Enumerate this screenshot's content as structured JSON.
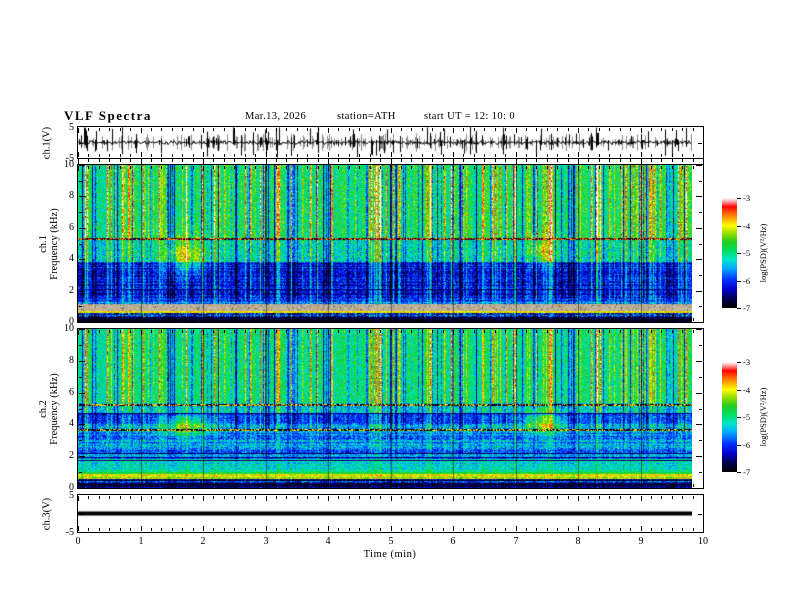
{
  "header": {
    "title": "VLF Spectra",
    "date": "Mar.13, 2026",
    "station": "station=ATH",
    "start_ut": "start UT =  12: 10: 0"
  },
  "time_axis": {
    "label": "Time  (min)",
    "min": 0,
    "max": 10,
    "tick_labels": [
      "0",
      "1",
      "2",
      "3",
      "4",
      "5",
      "6",
      "7",
      "8",
      "9",
      "10"
    ],
    "minor_ticks_per_interval": 5
  },
  "colorbar": {
    "label": "log(PSD)(V²/Hz)",
    "vmin": -7,
    "vmax": -3,
    "tick_labels": [
      "-3",
      "-4",
      "-5",
      "-6",
      "-7"
    ],
    "tick_values": [
      -3,
      -4,
      -5,
      -6,
      -7
    ],
    "stops": [
      [
        0.0,
        "#000000"
      ],
      [
        0.09,
        "#000055"
      ],
      [
        0.17,
        "#0000cc"
      ],
      [
        0.26,
        "#0033ff"
      ],
      [
        0.36,
        "#00aaff"
      ],
      [
        0.44,
        "#00e6cc"
      ],
      [
        0.52,
        "#00e060"
      ],
      [
        0.6,
        "#22cc22"
      ],
      [
        0.68,
        "#99dd00"
      ],
      [
        0.75,
        "#ffff00"
      ],
      [
        0.81,
        "#ffaa00"
      ],
      [
        0.87,
        "#ff5500"
      ],
      [
        0.92,
        "#ff0000"
      ],
      [
        0.965,
        "#ff9999"
      ],
      [
        1.0,
        "#ffffff"
      ]
    ]
  },
  "colors": {
    "trace": "#000000",
    "trace_shadow": "#8a8a8a",
    "frame": "#000000",
    "background": "#ffffff"
  },
  "sferics": {
    "seed": 20260313,
    "p_strong": 0.17,
    "strong_min": 0.55,
    "strong_max": 1.9,
    "p_quiet": 0.15,
    "quiet_min": 0.5,
    "quiet_max": 1.6,
    "jitter": 0.55,
    "smooth": 0.28
  },
  "chart_data": [
    {
      "id": "wave1",
      "type": "line",
      "title": "ch.1 time series",
      "ylabel": "ch.1(V)",
      "ylim": [
        -5,
        5
      ],
      "ytick_labels": [
        "5",
        "-5"
      ],
      "ytick_values": [
        5,
        -5
      ],
      "xlim_min": [
        0,
        10
      ],
      "data_end_min": 9.82,
      "description": "broadband VLF noise around 0 V with dense impulsive sferic spikes reaching ±5 V",
      "seed": 11,
      "center_jitter_v": 0.8,
      "gray_p": 0.34,
      "gray_vmax": 3.0,
      "spike_p": 0.17,
      "spike_vmax": 5
    },
    {
      "id": "spec1",
      "type": "heatmap",
      "title": "ch.1 spectrogram",
      "ylabel_lines": [
        "ch.1",
        "Frequency  (kHz)"
      ],
      "ylim": [
        0,
        10
      ],
      "ytick_values": [
        0,
        2,
        4,
        6,
        8,
        10
      ],
      "xlim_min": [
        0,
        10
      ],
      "data_end_min": 9.82,
      "value_label": "log(PSD)(V²/Hz)",
      "vlim": [
        -7,
        -3
      ],
      "seed": 42,
      "zones": [
        {
          "f0": 5.35,
          "f1": 10.01,
          "base": -4.85,
          "noise": 0.5,
          "gain": 1.5,
          "rowband": 0.0
        },
        {
          "f0": 3.85,
          "f1": 5.35,
          "base": -5.2,
          "noise": 0.55,
          "gain": 1.05,
          "rowband": 0.2
        },
        {
          "f0": 1.5,
          "f1": 3.85,
          "base": -6.15,
          "noise": 0.45,
          "gain": 0.8,
          "rowband": 0.6
        },
        {
          "f0": 1.15,
          "f1": 1.5,
          "base": -5.8,
          "noise": 0.5,
          "gain": 0.5,
          "rowband": 0.7
        },
        {
          "f0": 0.65,
          "f1": 1.15,
          "type": "gray"
        },
        {
          "f0": 0.3,
          "f1": 0.65,
          "base": -6.2,
          "noise": 0.85,
          "gain": 0.55,
          "rowband": 1.0
        },
        {
          "f0": 0.0,
          "f1": 0.3,
          "base": -6.8,
          "noise": 0.35,
          "gain": 0.3,
          "rowband": 1.0
        }
      ],
      "lines": [
        {
          "f": 5.3,
          "hw": 0.08,
          "v": -3.6,
          "dark": true
        },
        {
          "f": 0.63,
          "hw": 0.05,
          "v": -4.0
        },
        {
          "f": 2.08,
          "hw": 0.045,
          "v": -6.55
        },
        {
          "f": 0.13,
          "hw": 0.05,
          "v": -6.9
        }
      ],
      "blobs": [
        {
          "t": 1.72,
          "f": 4.2,
          "rt": 0.22,
          "rf": 0.8,
          "dv": 1.25
        },
        {
          "t": 7.45,
          "f": 4.6,
          "rt": 0.17,
          "rf": 0.6,
          "dv": 0.95
        }
      ]
    },
    {
      "id": "spec2",
      "type": "heatmap",
      "title": "ch.2 spectrogram",
      "ylabel_lines": [
        "ch.2",
        "Frequency  (kHz)"
      ],
      "ylim": [
        0,
        10
      ],
      "ytick_values": [
        0,
        2,
        4,
        6,
        8,
        10
      ],
      "xlim_min": [
        0,
        10
      ],
      "data_end_min": 9.82,
      "value_label": "log(PSD)(V²/Hz)",
      "vlim": [
        -7,
        -3
      ],
      "seed": 77,
      "zones": [
        {
          "f0": 5.35,
          "f1": 10.01,
          "base": -4.95,
          "noise": 0.45,
          "gain": 1.25,
          "rowband": 0.0
        },
        {
          "f0": 4.7,
          "f1": 5.35,
          "base": -5.3,
          "noise": 0.5,
          "gain": 0.9,
          "rowband": 0.3
        },
        {
          "f0": 4.05,
          "f1": 4.7,
          "base": -6.0,
          "noise": 0.45,
          "gain": 0.65,
          "rowband": 0.4
        },
        {
          "f0": 3.7,
          "f1": 4.05,
          "base": -5.45,
          "noise": 0.45,
          "gain": 0.8,
          "rowband": 0.4
        },
        {
          "f0": 2.3,
          "f1": 3.7,
          "base": -5.6,
          "noise": 0.5,
          "gain": 0.35,
          "rowband": 0.8
        },
        {
          "f0": 1.8,
          "f1": 2.3,
          "base": -5.7,
          "noise": 0.45,
          "gain": 0.3,
          "rowband": 0.8
        },
        {
          "f0": 0.9,
          "f1": 1.8,
          "base": -5.25,
          "noise": 0.35,
          "gain": 0.25,
          "rowband": 0.6
        },
        {
          "f0": 0.55,
          "f1": 0.9,
          "base": -4.15,
          "noise": 0.35,
          "gain": 0.2,
          "rowband": 0.5
        },
        {
          "f0": 0.3,
          "f1": 0.55,
          "base": -6.2,
          "noise": 0.6,
          "gain": 0.3,
          "rowband": 1.0
        },
        {
          "f0": 0.0,
          "f1": 0.3,
          "base": -6.8,
          "noise": 0.35,
          "gain": 0.2,
          "rowband": 1.0
        }
      ],
      "lines": [
        {
          "f": 5.2,
          "hw": 0.07,
          "v": -3.9,
          "dark": true
        },
        {
          "f": 4.68,
          "hw": 0.05,
          "v": -6.5
        },
        {
          "f": 3.67,
          "hw": 0.06,
          "v": -3.95,
          "dark": true
        },
        {
          "f": 2.15,
          "hw": 0.04,
          "v": -6.6
        },
        {
          "f": 1.93,
          "hw": 0.04,
          "v": -6.5
        },
        {
          "f": 1.74,
          "hw": 0.04,
          "v": -6.6
        },
        {
          "f": 0.95,
          "hw": 0.04,
          "v": -4.7
        },
        {
          "f": 0.47,
          "hw": 0.04,
          "v": -6.85
        }
      ],
      "blobs": [
        {
          "t": 1.72,
          "f": 3.95,
          "rt": 0.26,
          "rf": 0.5,
          "dv": 1.35
        },
        {
          "t": 7.45,
          "f": 4.15,
          "rt": 0.22,
          "rf": 0.5,
          "dv": 1.45
        }
      ]
    },
    {
      "id": "wave3",
      "type": "line",
      "title": "ch.3 time series",
      "ylabel": "ch.3(V)",
      "ylim": [
        -5,
        5
      ],
      "ytick_labels": [
        "5",
        "-5"
      ],
      "ytick_values": [
        5,
        -5
      ],
      "xlim_min": [
        0,
        10
      ],
      "data_end_min": 9.82,
      "values": "constant 0 V (flat line)",
      "line_value": 0,
      "thickness_px": 4
    }
  ],
  "spec_ytick_labels": [
    "0",
    "2",
    "4",
    "6",
    "8",
    "10"
  ]
}
